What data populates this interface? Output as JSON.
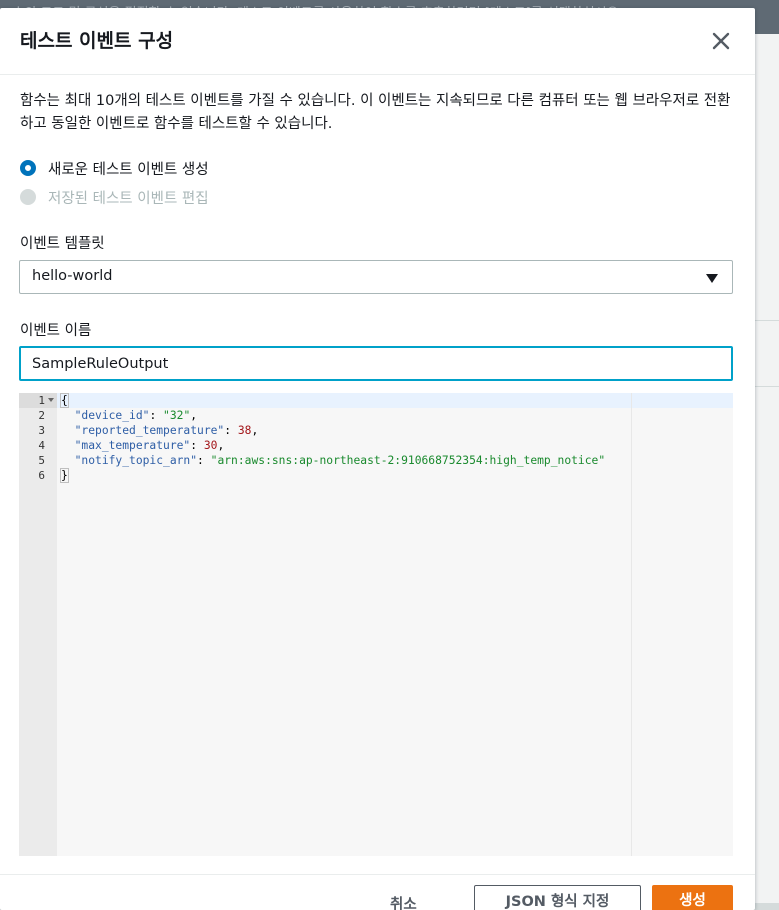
{
  "background": {
    "strip_text": "...수의 코드 및 구성을 편집할 수 있습니다. 테스트 이벤트를 사용하여 함수를 호출하려면 [테스트]를 선택하십시오."
  },
  "modal": {
    "title": "테스트 이벤트 구성",
    "description": "함수는 최대 10개의 테스트 이벤트를 가질 수 있습니다. 이 이벤트는 지속되므로 다른 컴퓨터 또는 웹 브라우저로 전환하고 동일한 이벤트로 함수를 테스트할 수 있습니다.",
    "radio_options": [
      {
        "label": "새로운 테스트 이벤트 생성",
        "selected": true,
        "disabled": false
      },
      {
        "label": "저장된 테스트 이벤트 편집",
        "selected": false,
        "disabled": true
      }
    ],
    "template_label": "이벤트 템플릿",
    "template_value": "hello-world",
    "event_name_label": "이벤트 이름",
    "event_name_value": "SampleRuleOutput"
  },
  "editor": {
    "line_numbers": [
      "1",
      "2",
      "3",
      "4",
      "5",
      "6"
    ],
    "open_brace": "{",
    "close_brace": "}",
    "entries": [
      {
        "key": "\"device_id\"",
        "value": "\"32\"",
        "value_type": "string",
        "trail": ","
      },
      {
        "key": "\"reported_temperature\"",
        "value": "38",
        "value_type": "number",
        "trail": ","
      },
      {
        "key": "\"max_temperature\"",
        "value": "30",
        "value_type": "number",
        "trail": ","
      },
      {
        "key": "\"notify_topic_arn\"",
        "value": "\"arn:aws:sns:ap-northeast-2:910668752354:high_temp_notice\"",
        "value_type": "string",
        "trail": ""
      }
    ]
  },
  "footer": {
    "cancel_label": "취소",
    "format_label": "JSON 형식 지정",
    "create_label": "생성"
  },
  "colors": {
    "primary_button": "#ec7211",
    "focus_border": "#00a1c9",
    "radio_selected": "#0073bb"
  },
  "icons": {
    "close": "close-icon",
    "dropdown": "caret-down-icon",
    "fold": "fold-arrow-icon"
  }
}
